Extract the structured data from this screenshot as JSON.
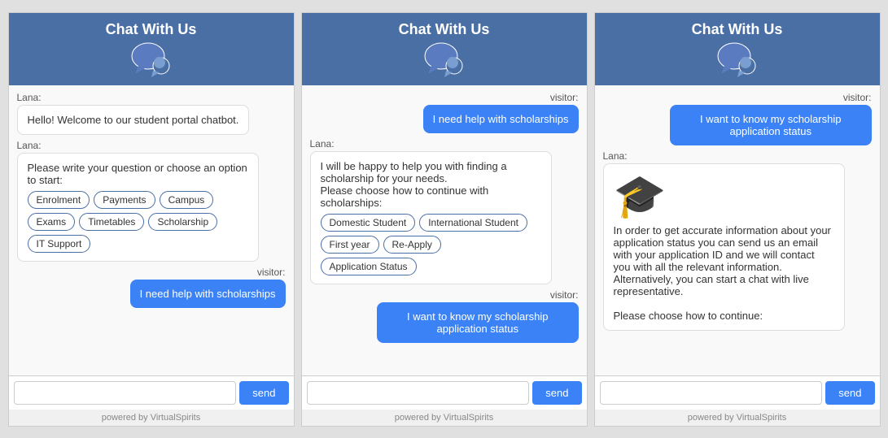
{
  "header": {
    "title": "Chat With Us"
  },
  "widget1": {
    "messages": [
      {
        "type": "bot",
        "sender": "Lana:",
        "text": "Hello! Welcome to our student portal chatbot."
      },
      {
        "type": "bot",
        "sender": "Lana:",
        "text": "Please write your question or choose an option to start:",
        "options": [
          "Enrolment",
          "Payments",
          "Campus",
          "Exams",
          "Timetables",
          "Scholarship",
          "IT Support"
        ]
      },
      {
        "type": "visitor",
        "text": "I need help with scholarships"
      }
    ],
    "input_placeholder": "",
    "send_label": "send"
  },
  "widget2": {
    "messages": [
      {
        "type": "visitor",
        "text": "I need help with scholarships"
      },
      {
        "type": "bot",
        "sender": "Lana:",
        "text": "I will be happy to help you with finding a scholarship for your needs.\nPlease choose how to continue with scholarships:",
        "options": [
          "Domestic Student",
          "International Student",
          "First year",
          "Re-Apply",
          "Application Status"
        ]
      },
      {
        "type": "visitor",
        "text": "I want to know my scholarship application status"
      }
    ],
    "input_placeholder": "",
    "send_label": "send"
  },
  "widget3": {
    "messages": [
      {
        "type": "visitor",
        "text": "I want to know my scholarship application status"
      },
      {
        "type": "bot",
        "sender": "Lana:",
        "has_icon": true,
        "text": "In order to get accurate information about your application status you can send us an email with your application ID and we will contact you with all the relevant information. Alternatively, you can start a chat with live representative.\n\nPlease choose how to continue:"
      }
    ],
    "input_placeholder": "",
    "send_label": "send"
  },
  "footer": {
    "powered_by": "powered by VirtualSpirits"
  }
}
